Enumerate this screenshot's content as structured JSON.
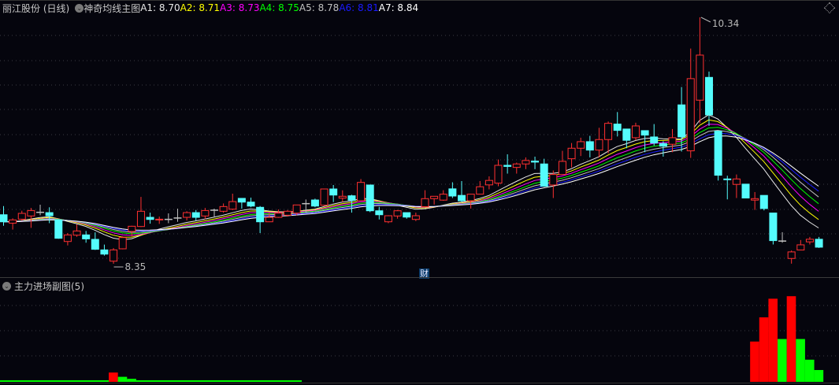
{
  "header": {
    "stock_name": "丽江股份 (日线)",
    "indicator_name": "神奇均线主图",
    "ma_values": [
      {
        "label": "A1:",
        "value": "8.70",
        "color": "#e8e8e8"
      },
      {
        "label": "A2:",
        "value": "8.71",
        "color": "#ffff00"
      },
      {
        "label": "A3:",
        "value": "8.73",
        "color": "#ff00ff"
      },
      {
        "label": "A4:",
        "value": "8.75",
        "color": "#00ff00"
      },
      {
        "label": "A5:",
        "value": "8.78",
        "color": "#c0c0c0"
      },
      {
        "label": "A6:",
        "value": "8.81",
        "color": "#1a1aff"
      },
      {
        "label": "A7:",
        "value": "8.84",
        "color": "#ffffff"
      }
    ]
  },
  "annotations": {
    "high_label": "10.34",
    "low_label": "8.35",
    "finance_marker": "财"
  },
  "sub_panel": {
    "title": "主力进场副图(5)"
  },
  "colors": {
    "up": "#ff3030",
    "down": "#54fcfc",
    "doji": "#c0c0c0",
    "bar_red": "#ff0000",
    "bar_green": "#00ff00"
  },
  "chart_data": {
    "type": "candlestick",
    "price_range": [
      8.35,
      10.34
    ],
    "candles": [
      [
        8.746,
        8.816,
        8.657,
        8.689
      ],
      [
        8.678,
        8.717,
        8.626,
        8.704
      ],
      [
        8.71,
        8.778,
        8.7,
        8.757
      ],
      [
        8.736,
        8.801,
        8.64,
        8.78
      ],
      [
        8.767,
        8.827,
        8.742,
        8.767
      ],
      [
        8.763,
        8.806,
        8.678,
        8.738
      ],
      [
        8.704,
        8.71,
        8.552,
        8.556
      ],
      [
        8.53,
        8.598,
        8.498,
        8.583
      ],
      [
        8.581,
        8.668,
        8.568,
        8.615
      ],
      [
        8.583,
        8.615,
        8.52,
        8.551
      ],
      [
        8.547,
        8.604,
        8.462,
        8.467
      ],
      [
        8.462,
        8.505,
        8.416,
        8.428
      ],
      [
        8.371,
        8.477,
        8.35,
        8.462
      ],
      [
        8.471,
        8.572,
        8.467,
        8.562
      ],
      [
        8.611,
        8.657,
        8.572,
        8.653
      ],
      [
        8.651,
        8.89,
        8.647,
        8.774
      ],
      [
        8.725,
        8.763,
        8.674,
        8.708
      ],
      [
        8.704,
        8.731,
        8.672,
        8.71
      ],
      [
        8.71,
        8.757,
        8.678,
        8.71
      ],
      [
        8.721,
        8.795,
        8.689,
        8.721
      ],
      [
        8.725,
        8.774,
        8.7,
        8.763
      ],
      [
        8.763,
        8.784,
        8.7,
        8.725
      ],
      [
        8.736,
        8.801,
        8.71,
        8.78
      ],
      [
        8.784,
        8.795,
        8.725,
        8.784
      ],
      [
        8.774,
        8.837,
        8.763,
        8.812
      ],
      [
        8.791,
        8.916,
        8.784,
        8.852
      ],
      [
        8.878,
        8.878,
        8.795,
        8.848
      ],
      [
        8.848,
        8.884,
        8.806,
        8.816
      ],
      [
        8.806,
        8.816,
        8.598,
        8.689
      ],
      [
        8.689,
        8.763,
        8.689,
        8.725
      ],
      [
        8.725,
        8.789,
        8.721,
        8.759
      ],
      [
        8.742,
        8.784,
        8.731,
        8.774
      ],
      [
        8.759,
        8.825,
        8.742,
        8.825
      ],
      [
        8.837,
        8.869,
        8.763,
        8.837
      ],
      [
        8.865,
        8.876,
        8.806,
        8.816
      ],
      [
        8.823,
        8.954,
        8.816,
        8.954
      ],
      [
        8.954,
        8.986,
        8.848,
        8.905
      ],
      [
        8.88,
        8.943,
        8.848,
        8.895
      ],
      [
        8.899,
        8.907,
        8.763,
        8.863
      ],
      [
        8.859,
        9.034,
        8.859,
        9.007
      ],
      [
        8.986,
        8.986,
        8.767,
        8.778
      ],
      [
        8.778,
        8.81,
        8.708,
        8.746
      ],
      [
        8.689,
        8.742,
        8.678,
        8.738
      ],
      [
        8.736,
        8.784,
        8.714,
        8.778
      ],
      [
        8.763,
        8.763,
        8.714,
        8.727
      ],
      [
        8.708,
        8.763,
        8.695,
        8.738
      ],
      [
        8.811,
        8.944,
        8.806,
        8.876
      ],
      [
        8.876,
        8.895,
        8.828,
        8.895
      ],
      [
        8.864,
        8.944,
        8.859,
        8.912
      ],
      [
        8.955,
        9.008,
        8.881,
        8.897
      ],
      [
        8.902,
        9.018,
        8.849,
        8.859
      ],
      [
        8.859,
        8.912,
        8.796,
        8.912
      ],
      [
        8.912,
        9.018,
        8.912,
        8.972
      ],
      [
        8.987,
        9.056,
        8.951,
        9.023
      ],
      [
        9.001,
        9.192,
        8.976,
        9.145
      ],
      [
        9.145,
        9.234,
        9.078,
        9.136
      ],
      [
        9.128,
        9.167,
        9.078,
        9.156
      ],
      [
        9.156,
        9.209,
        9.114,
        9.184
      ],
      [
        9.179,
        9.215,
        9.114,
        9.171
      ],
      [
        9.156,
        9.198,
        8.972,
        8.976
      ],
      [
        8.986,
        9.103,
        8.881,
        9.071
      ],
      [
        9.071,
        9.262,
        9.071,
        9.177
      ],
      [
        9.198,
        9.325,
        9.128,
        9.283
      ],
      [
        9.283,
        9.368,
        9.22,
        9.336
      ],
      [
        9.336,
        9.383,
        9.209,
        9.268
      ],
      [
        9.268,
        9.448,
        9.209,
        9.353
      ],
      [
        9.353,
        9.499,
        9.241,
        9.484
      ],
      [
        9.478,
        9.575,
        9.378,
        9.427
      ],
      [
        9.438,
        9.438,
        9.283,
        9.347
      ],
      [
        9.368,
        9.489,
        9.347,
        9.463
      ],
      [
        9.425,
        9.425,
        9.251,
        9.389
      ],
      [
        9.374,
        9.478,
        9.304,
        9.325
      ],
      [
        9.321,
        9.34,
        9.215,
        9.3
      ],
      [
        9.315,
        9.438,
        9.251,
        9.368
      ],
      [
        9.633,
        9.777,
        9.256,
        9.374
      ],
      [
        9.262,
        10.088,
        9.205,
        9.845
      ],
      [
        9.671,
        10.34,
        9.484,
        10.035
      ],
      [
        9.855,
        9.902,
        9.463,
        9.552
      ],
      [
        9.421,
        9.421,
        9.022,
        9.065
      ],
      [
        9.035,
        9.061,
        8.87,
        9.029
      ],
      [
        8.991,
        9.071,
        8.881,
        9.035
      ],
      [
        8.993,
        8.993,
        8.881,
        8.881
      ],
      [
        8.864,
        8.929,
        8.785,
        8.876
      ],
      [
        8.902,
        8.902,
        8.781,
        8.796
      ],
      [
        8.76,
        8.76,
        8.506,
        8.537
      ],
      [
        8.535,
        8.605,
        8.52,
        8.535
      ],
      [
        8.393,
        8.457,
        8.351,
        8.446
      ],
      [
        8.461,
        8.542,
        8.461,
        8.503
      ],
      [
        8.527,
        8.567,
        8.506,
        8.548
      ],
      [
        8.548,
        8.567,
        8.478,
        8.484
      ]
    ],
    "candle_fields": [
      "open",
      "high",
      "low",
      "close"
    ],
    "sub_bars": [
      {
        "index": 12,
        "value": 0.37,
        "color": "red"
      },
      {
        "index": 13,
        "value": 0.2,
        "color": "green"
      },
      {
        "index": 14,
        "value": 0.12,
        "color": "green"
      },
      {
        "index": 15,
        "value": 0.06,
        "color": "green"
      },
      {
        "index": 16,
        "value": 0.06,
        "color": "green"
      },
      {
        "index": 82,
        "value": 1.6,
        "color": "red"
      },
      {
        "index": 83,
        "value": 2.56,
        "color": "red"
      },
      {
        "index": 84,
        "value": 3.3,
        "color": "red"
      },
      {
        "index": 85,
        "value": 1.7,
        "color": "green"
      },
      {
        "index": 86,
        "value": 3.4,
        "color": "red"
      },
      {
        "index": 87,
        "value": 1.7,
        "color": "green"
      },
      {
        "index": 88,
        "value": 0.88,
        "color": "green"
      },
      {
        "index": 89,
        "value": 0.47,
        "color": "green"
      }
    ],
    "sub_baseline_range": [
      0,
      32
    ]
  }
}
